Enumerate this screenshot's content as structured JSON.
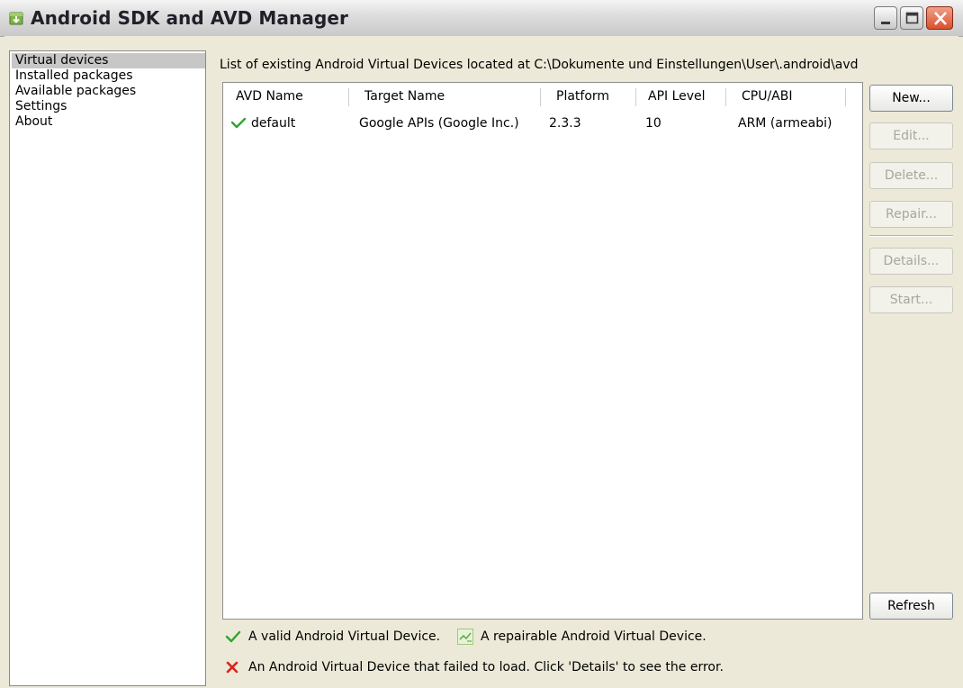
{
  "window": {
    "title": "Android SDK and AVD Manager"
  },
  "sidebar": {
    "items": [
      {
        "label": "Virtual devices",
        "selected": true
      },
      {
        "label": "Installed packages",
        "selected": false
      },
      {
        "label": "Available packages",
        "selected": false
      },
      {
        "label": "Settings",
        "selected": false
      },
      {
        "label": "About",
        "selected": false
      }
    ]
  },
  "main": {
    "header": "List of existing Android Virtual Devices located at C:\\Dokumente und Einstellungen\\User\\.android\\avd",
    "table": {
      "columns": [
        "AVD Name",
        "Target Name",
        "Platform",
        "API Level",
        "CPU/ABI"
      ],
      "rows": [
        {
          "status": "valid",
          "name": "default",
          "target": "Google APIs (Google Inc.)",
          "platform": "2.3.3",
          "api_level": "10",
          "cpu_abi": "ARM (armeabi)"
        }
      ]
    },
    "buttons": {
      "new": "New...",
      "edit": "Edit...",
      "delete": "Delete...",
      "repair": "Repair...",
      "details": "Details...",
      "start": "Start...",
      "refresh": "Refresh"
    },
    "legend": {
      "valid": "A valid Android Virtual Device.",
      "repairable": "A repairable Android Virtual Device.",
      "failed": "An Android Virtual Device that failed to load. Click 'Details' to see the error."
    }
  },
  "colors": {
    "valid_check": "#2fa52f",
    "failed_x": "#d8261c",
    "selection": "#c7c7c7"
  }
}
